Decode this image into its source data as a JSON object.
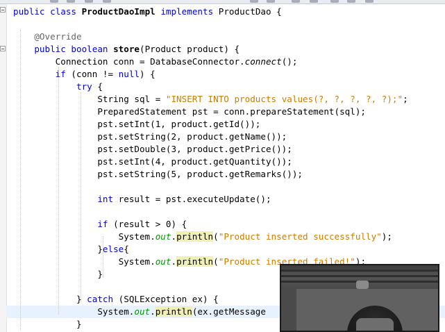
{
  "editor": {
    "lines": [
      [
        {
          "t": "public class ",
          "c": "k"
        },
        {
          "t": "ProductDaoImpl",
          "c": "bold"
        },
        {
          "t": " "
        },
        {
          "t": "implements",
          "c": "k"
        },
        {
          "t": " ProductDao {"
        }
      ],
      [],
      [
        {
          "t": "    "
        },
        {
          "t": "@Override",
          "c": "ann"
        }
      ],
      [
        {
          "t": "    "
        },
        {
          "t": "public boolean ",
          "c": "k"
        },
        {
          "t": "store",
          "c": "bold"
        },
        {
          "t": "(Product product) {"
        }
      ],
      [
        {
          "t": "        Connection conn = DatabaseConnector."
        },
        {
          "t": "connect",
          "c": "it"
        },
        {
          "t": "();"
        }
      ],
      [
        {
          "t": "        "
        },
        {
          "t": "if",
          "c": "k"
        },
        {
          "t": " (conn != "
        },
        {
          "t": "null",
          "c": "k"
        },
        {
          "t": ") {"
        }
      ],
      [
        {
          "t": "            "
        },
        {
          "t": "try",
          "c": "k"
        },
        {
          "t": " {"
        }
      ],
      [
        {
          "t": "                String sql = "
        },
        {
          "t": "\"INSERT INTO products values(?, ?, ?, ?, ?);\"",
          "c": "s"
        },
        {
          "t": ";"
        }
      ],
      [
        {
          "t": "                PreparedStatement pst = conn.prepareStatement(sql);"
        }
      ],
      [
        {
          "t": "                pst.setInt(1, product.getId());"
        }
      ],
      [
        {
          "t": "                pst.setString(2, product.getName());"
        }
      ],
      [
        {
          "t": "                pst.setDouble(3, product.getPrice());"
        }
      ],
      [
        {
          "t": "                pst.setInt(4, product.getQuantity());"
        }
      ],
      [
        {
          "t": "                pst.setString(5, product.getRemarks());"
        }
      ],
      [],
      [
        {
          "t": "                "
        },
        {
          "t": "int",
          "c": "k"
        },
        {
          "t": " result = pst.executeUpdate();"
        }
      ],
      [],
      [
        {
          "t": "                "
        },
        {
          "t": "if",
          "c": "k"
        },
        {
          "t": " (result > 0) {"
        }
      ],
      [
        {
          "t": "                    System."
        },
        {
          "t": "out",
          "c": "fld"
        },
        {
          "t": "."
        },
        {
          "t": "println",
          "c": "mark"
        },
        {
          "t": "("
        },
        {
          "t": "\"Product inserted successfully\"",
          "c": "s"
        },
        {
          "t": ");"
        }
      ],
      [
        {
          "t": "                }"
        },
        {
          "t": "else",
          "c": "k"
        },
        {
          "t": "{"
        }
      ],
      [
        {
          "t": "                    System."
        },
        {
          "t": "out",
          "c": "fld"
        },
        {
          "t": "."
        },
        {
          "t": "println",
          "c": "mark"
        },
        {
          "t": "("
        },
        {
          "t": "\"Product inserted failed!\"",
          "c": "s"
        },
        {
          "t": ");"
        }
      ],
      [
        {
          "t": "                }"
        }
      ],
      [],
      [
        {
          "t": "            } "
        },
        {
          "t": "catch",
          "c": "k"
        },
        {
          "t": " (SQLException ex) {"
        }
      ],
      [
        {
          "t": "                System."
        },
        {
          "t": "out",
          "c": "fld"
        },
        {
          "t": "."
        },
        {
          "t": "println",
          "c": "mark"
        },
        {
          "t": "(ex.getMessage"
        }
      ],
      [
        {
          "t": "            }"
        }
      ]
    ],
    "highlighted_line": 24
  },
  "colors": {
    "keyword": "#0000e6",
    "string": "#ce7b00",
    "field": "#009900",
    "annotation": "#666666",
    "current_line": "#e8f2fe",
    "occurrence_mark": "#f0f0b2"
  },
  "webcam": {
    "description_icon": "webcam-overlay"
  }
}
